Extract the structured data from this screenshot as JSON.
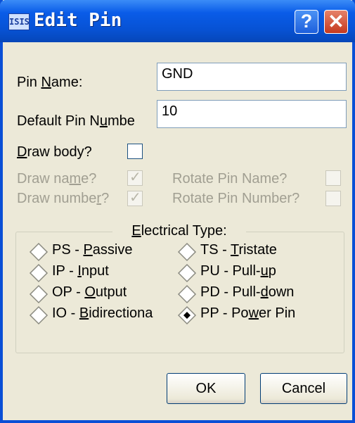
{
  "window": {
    "app_icon_text": "ISIS",
    "title": "Edit Pin",
    "help_glyph": "?",
    "close_glyph": "✕"
  },
  "fields": {
    "pin_name": {
      "label_pre": "Pin ",
      "label_key": "N",
      "label_post": "ame:",
      "value": "GND"
    },
    "pin_number": {
      "label_pre": "Default Pin N",
      "label_key": "u",
      "label_post": "mbe",
      "value": "10"
    }
  },
  "checks": {
    "draw_body": {
      "label_key": "D",
      "label_post": "raw body?",
      "checked": false,
      "enabled": true
    },
    "draw_name": {
      "label_pre": "Draw na",
      "label_key": "m",
      "label_post": "e?",
      "checked": true,
      "enabled": false
    },
    "draw_number": {
      "label_pre": "Draw numbe",
      "label_key": "r",
      "label_post": "?",
      "checked": true,
      "enabled": false
    },
    "rotate_pin_name": {
      "label": "Rotate Pin Name?",
      "checked": false,
      "enabled": false
    },
    "rotate_pin_number": {
      "label": "Rotate Pin Number?",
      "checked": false,
      "enabled": false
    },
    "check_glyph": "✓"
  },
  "electrical_type": {
    "title_key": "E",
    "title_post": "lectrical Type:",
    "options": [
      {
        "pre": "PS - ",
        "key": "P",
        "post": "assive",
        "selected": false
      },
      {
        "pre": "IP - ",
        "key": "I",
        "post": "nput",
        "selected": false
      },
      {
        "pre": "OP - ",
        "key": "O",
        "post": "utput",
        "selected": false
      },
      {
        "pre": "IO - ",
        "key": "B",
        "post": "idirectiona",
        "selected": false
      },
      {
        "pre": "TS - ",
        "key": "T",
        "post": "ristate",
        "selected": false
      },
      {
        "pre": "PU - Pull-",
        "key": "u",
        "post": "p",
        "selected": false
      },
      {
        "pre": "PD - Pull-",
        "key": "d",
        "post": "own",
        "selected": false
      },
      {
        "pre": "PP - Po",
        "key": "w",
        "post": "er Pin",
        "selected": true
      }
    ]
  },
  "buttons": {
    "ok": "OK",
    "cancel": "Cancel"
  }
}
